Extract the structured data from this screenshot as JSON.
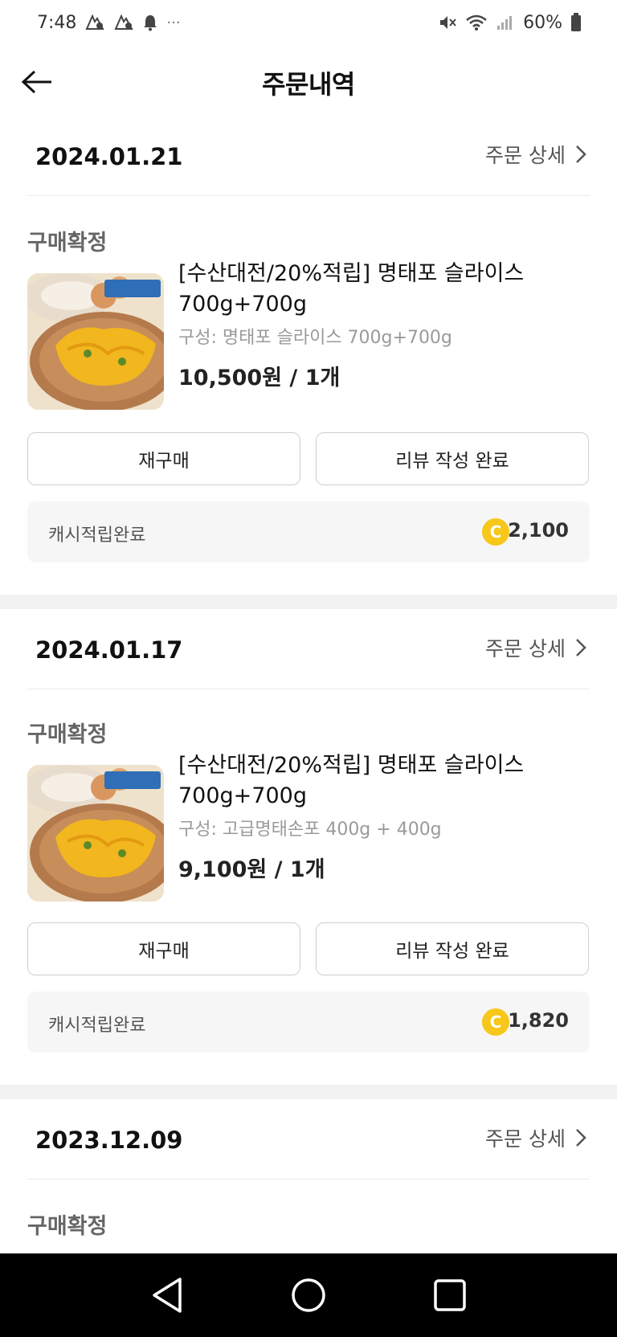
{
  "status_bar": {
    "time": "7:48",
    "dots": "···",
    "battery": "60%"
  },
  "header": {
    "title": "주문내역"
  },
  "orders": [
    {
      "date": "2024.01.21",
      "detail_label": "주문 상세",
      "status": "구매확정",
      "product_name": "[수산대전/20%적립] 명태포 슬라이스 700g+700g",
      "option": "구성: 명태포 슬라이스 700g+700g",
      "price": "10,500원 / 1개",
      "rebuy_label": "재구매",
      "review_label": "리뷰 작성 완료",
      "cash_label": "캐시적립완료",
      "cash_amount": "2,100"
    },
    {
      "date": "2024.01.17",
      "detail_label": "주문 상세",
      "status": "구매확정",
      "product_name": "[수산대전/20%적립] 명태포 슬라이스 700g+700g",
      "option": "구성: 고급명태손포 400g + 400g",
      "price": "9,100원 / 1개",
      "rebuy_label": "재구매",
      "review_label": "리뷰 작성 완료",
      "cash_label": "캐시적립완료",
      "cash_amount": "1,820"
    },
    {
      "date": "2023.12.09",
      "detail_label": "주문 상세",
      "status": "구매확정"
    }
  ],
  "coin_symbol": "C",
  "colors": {
    "coin": "#f7c71a",
    "divider": "#f2f2f2",
    "cash_box": "#f6f6f6"
  }
}
